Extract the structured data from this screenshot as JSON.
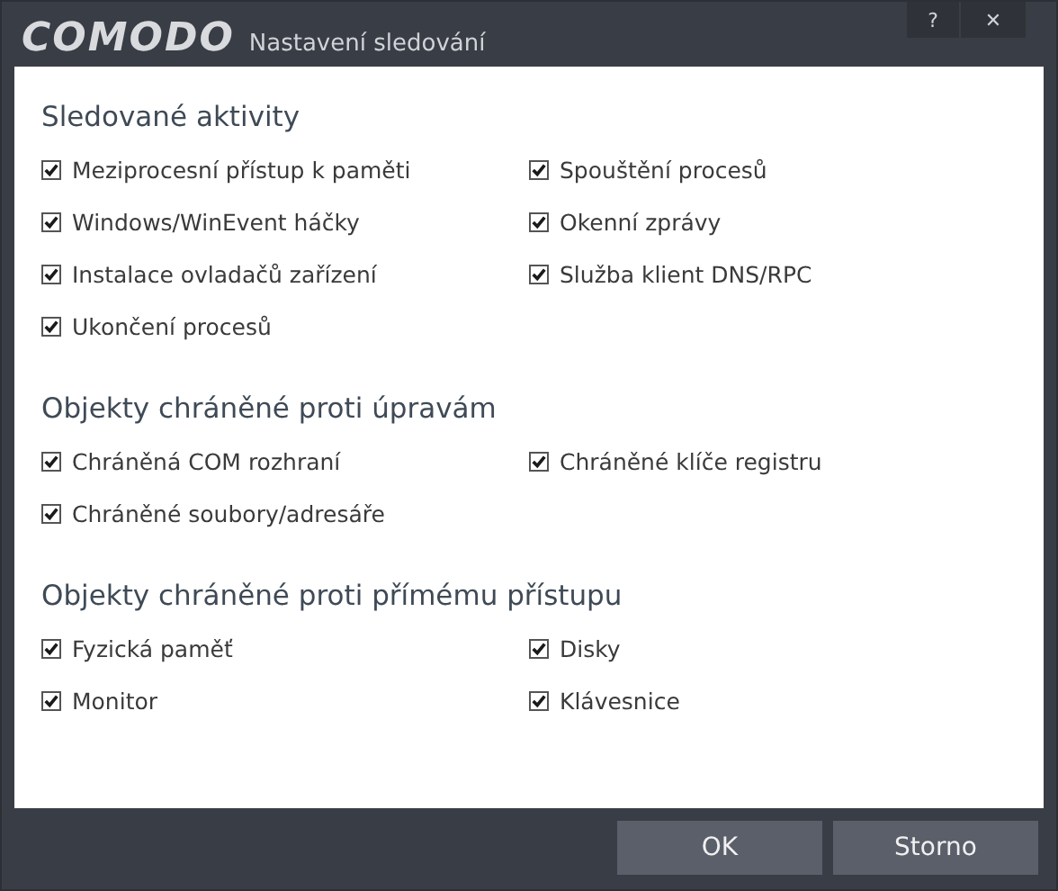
{
  "window": {
    "logo": "COMODO",
    "title": "Nastavení sledování",
    "controls": [
      "?",
      "✕"
    ]
  },
  "sections": [
    {
      "heading": "Sledované aktivity",
      "items": [
        {
          "label": "Meziprocesní přístup k paměti",
          "checked": true
        },
        {
          "label": "Spouštění procesů",
          "checked": true
        },
        {
          "label": "Windows/WinEvent háčky",
          "checked": true
        },
        {
          "label": "Okenní zprávy",
          "checked": true
        },
        {
          "label": "Instalace ovladačů zařízení",
          "checked": true
        },
        {
          "label": "Služba klient DNS/RPC",
          "checked": true
        },
        {
          "label": "Ukončení procesů",
          "checked": true
        }
      ]
    },
    {
      "heading": "Objekty chráněné proti úpravám",
      "items": [
        {
          "label": "Chráněná COM rozhraní",
          "checked": true
        },
        {
          "label": "Chráněné klíče registru",
          "checked": true
        },
        {
          "label": "Chráněné soubory/adresáře",
          "checked": true
        }
      ]
    },
    {
      "heading": "Objekty chráněné proti přímému přístupu",
      "items": [
        {
          "label": "Fyzická paměť",
          "checked": true
        },
        {
          "label": "Disky",
          "checked": true
        },
        {
          "label": "Monitor",
          "checked": true
        },
        {
          "label": "Klávesnice",
          "checked": true
        }
      ]
    }
  ],
  "buttons": [
    "OK",
    "Storno"
  ]
}
